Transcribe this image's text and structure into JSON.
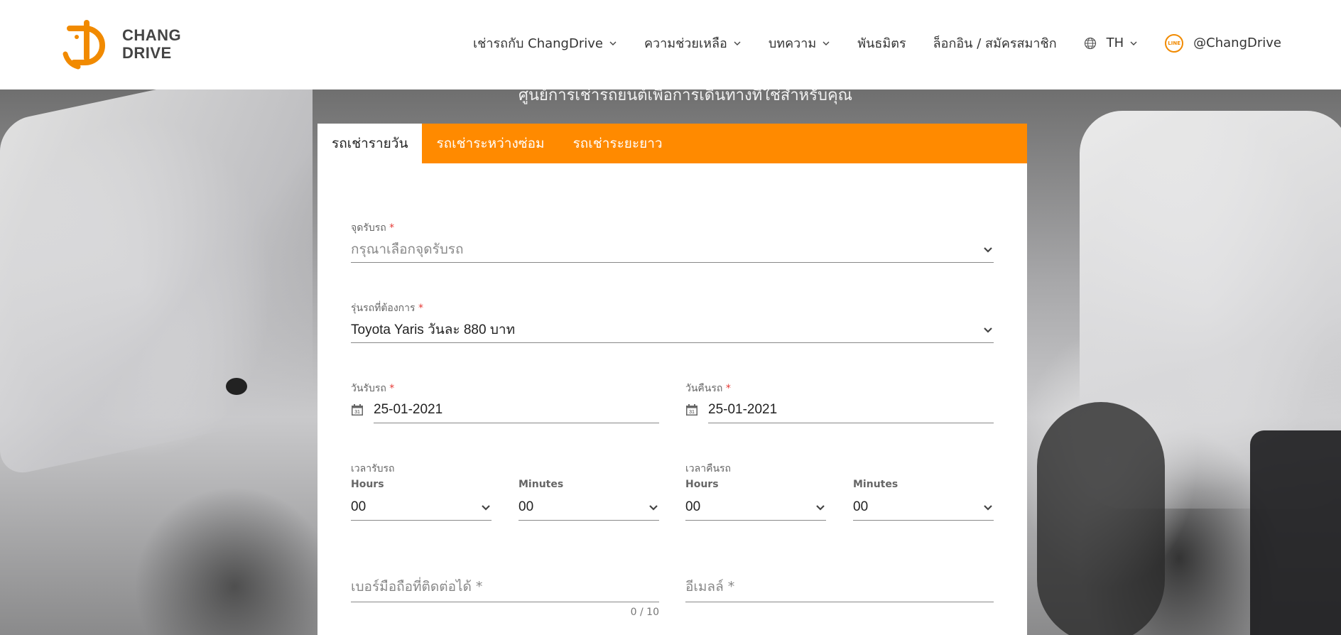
{
  "brand": {
    "line1": "CHANG",
    "line2": "DRIVE"
  },
  "nav": {
    "items": [
      {
        "label": "เช่ารถกับ ChangDrive",
        "dropdown": true
      },
      {
        "label": "ความช่วยเหลือ",
        "dropdown": true
      },
      {
        "label": "บทความ",
        "dropdown": true
      },
      {
        "label": "พันธมิตร",
        "dropdown": false
      },
      {
        "label": "ล็อกอิน / สมัครสมาชิก",
        "dropdown": false
      }
    ],
    "language": "TH",
    "line_handle": "@ChangDrive",
    "line_icon_text": "LINE"
  },
  "hero": {
    "tagline": "ศูนย์การเช่ารถยนต์เพื่อการเดินทางที่ใช่สำหรับคุณ"
  },
  "tabs": [
    {
      "label": "รถเช่ารายวัน",
      "active": true
    },
    {
      "label": "รถเช่าระหว่างซ่อม",
      "active": false
    },
    {
      "label": "รถเช่าระยะยาว",
      "active": false
    }
  ],
  "form": {
    "pickup_location": {
      "label": "จุดรับรถ",
      "required_mark": "*",
      "placeholder": "กรุณาเลือกจุดรับรถ"
    },
    "car_model": {
      "label": "รุ่นรถที่ต้องการ",
      "required_mark": "*",
      "value": "Toyota Yaris วันละ 880 บาท"
    },
    "pickup_date": {
      "label": "วันรับรถ",
      "required_mark": "*",
      "value": "25-01-2021",
      "icon_text": "31"
    },
    "return_date": {
      "label": "วันคืนรถ",
      "required_mark": "*",
      "value": "25-01-2021",
      "icon_text": "31"
    },
    "pickup_time": {
      "label": "เวลารับรถ",
      "hours_label": "Hours",
      "minutes_label": "Minutes",
      "hours": "00",
      "minutes": "00"
    },
    "return_time": {
      "label": "เวลาคืนรถ",
      "hours_label": "Hours",
      "minutes_label": "Minutes",
      "hours": "00",
      "minutes": "00"
    },
    "phone": {
      "placeholder": "เบอร์มือถือที่ติดต่อได้ *",
      "counter": "0 / 10"
    },
    "email": {
      "placeholder": "อีเมลล์ *"
    }
  },
  "colors": {
    "accent": "#ff8a00",
    "brand_orange": "#f18a00",
    "text": "#222222"
  }
}
